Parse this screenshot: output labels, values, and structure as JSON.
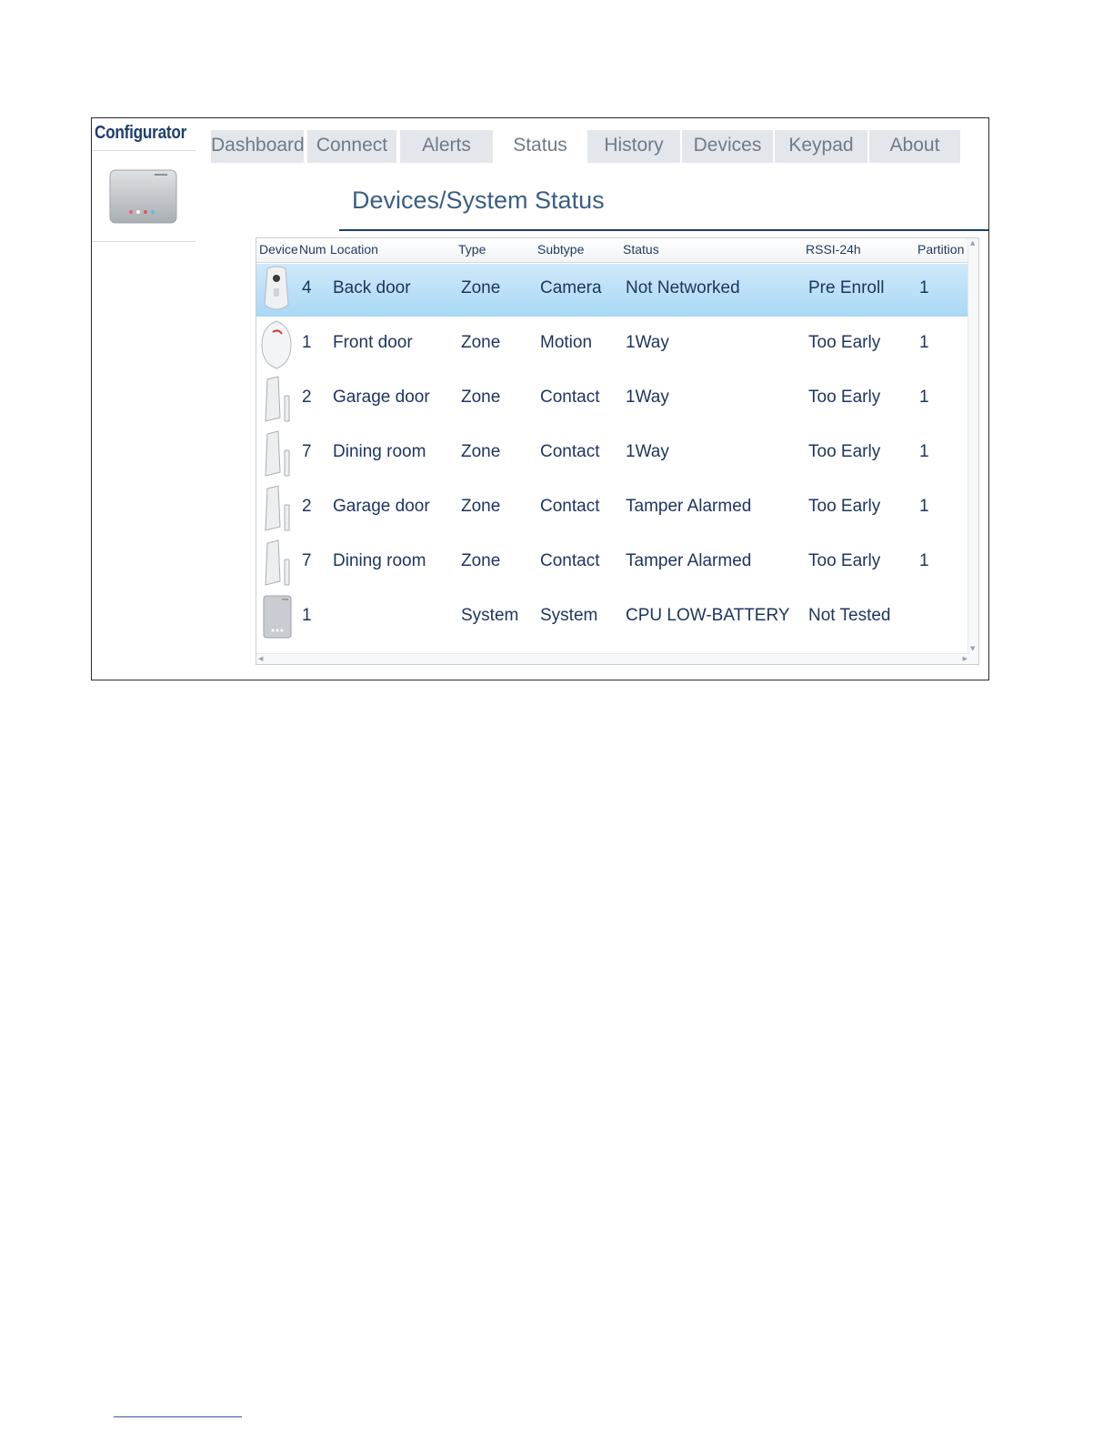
{
  "app": {
    "brand": "Configurator"
  },
  "tabs": [
    {
      "label": "Dashboard"
    },
    {
      "label": "Connect"
    },
    {
      "label": "Alerts"
    },
    {
      "label": "Status",
      "active": true
    },
    {
      "label": "History"
    },
    {
      "label": "Devices"
    },
    {
      "label": "Keypad"
    },
    {
      "label": "About"
    }
  ],
  "page": {
    "title": "Devices/System Status"
  },
  "table": {
    "columns": [
      "Device",
      "Num",
      "Location",
      "Type",
      "Subtype",
      "Status",
      "RSSI-24h",
      "Partition"
    ],
    "rows": [
      {
        "icon": "camera-icon",
        "num": "4",
        "location": "Back door",
        "type": "Zone",
        "subtype": "Camera",
        "status": "Not Networked",
        "rssi": "Pre Enroll",
        "partition": "1",
        "selected": true
      },
      {
        "icon": "motion-sensor-icon",
        "num": "1",
        "location": "Front door",
        "type": "Zone",
        "subtype": "Motion",
        "status": "1Way",
        "rssi": "Too Early",
        "partition": "1"
      },
      {
        "icon": "contact-sensor-icon",
        "num": "2",
        "location": "Garage door",
        "type": "Zone",
        "subtype": "Contact",
        "status": "1Way",
        "rssi": "Too Early",
        "partition": "1"
      },
      {
        "icon": "contact-sensor-icon",
        "num": "7",
        "location": "Dining room",
        "type": "Zone",
        "subtype": "Contact",
        "status": "1Way",
        "rssi": "Too Early",
        "partition": "1"
      },
      {
        "icon": "contact-sensor-icon",
        "num": "2",
        "location": "Garage door",
        "type": "Zone",
        "subtype": "Contact",
        "status": "Tamper Alarmed",
        "rssi": "Too Early",
        "partition": "1"
      },
      {
        "icon": "contact-sensor-icon",
        "num": "7",
        "location": "Dining room",
        "type": "Zone",
        "subtype": "Contact",
        "status": "Tamper Alarmed",
        "rssi": "Too Early",
        "partition": "1"
      },
      {
        "icon": "control-panel-icon",
        "num": "1",
        "location": "",
        "type": "System",
        "subtype": "System",
        "status": "CPU LOW-BATTERY",
        "rssi": "Not Tested",
        "partition": ""
      }
    ]
  },
  "colors": {
    "brand": "#1d3f6e",
    "text": "#1e3560",
    "selection": "#a9d8f5",
    "tab_bg": "#e3e6ea"
  }
}
